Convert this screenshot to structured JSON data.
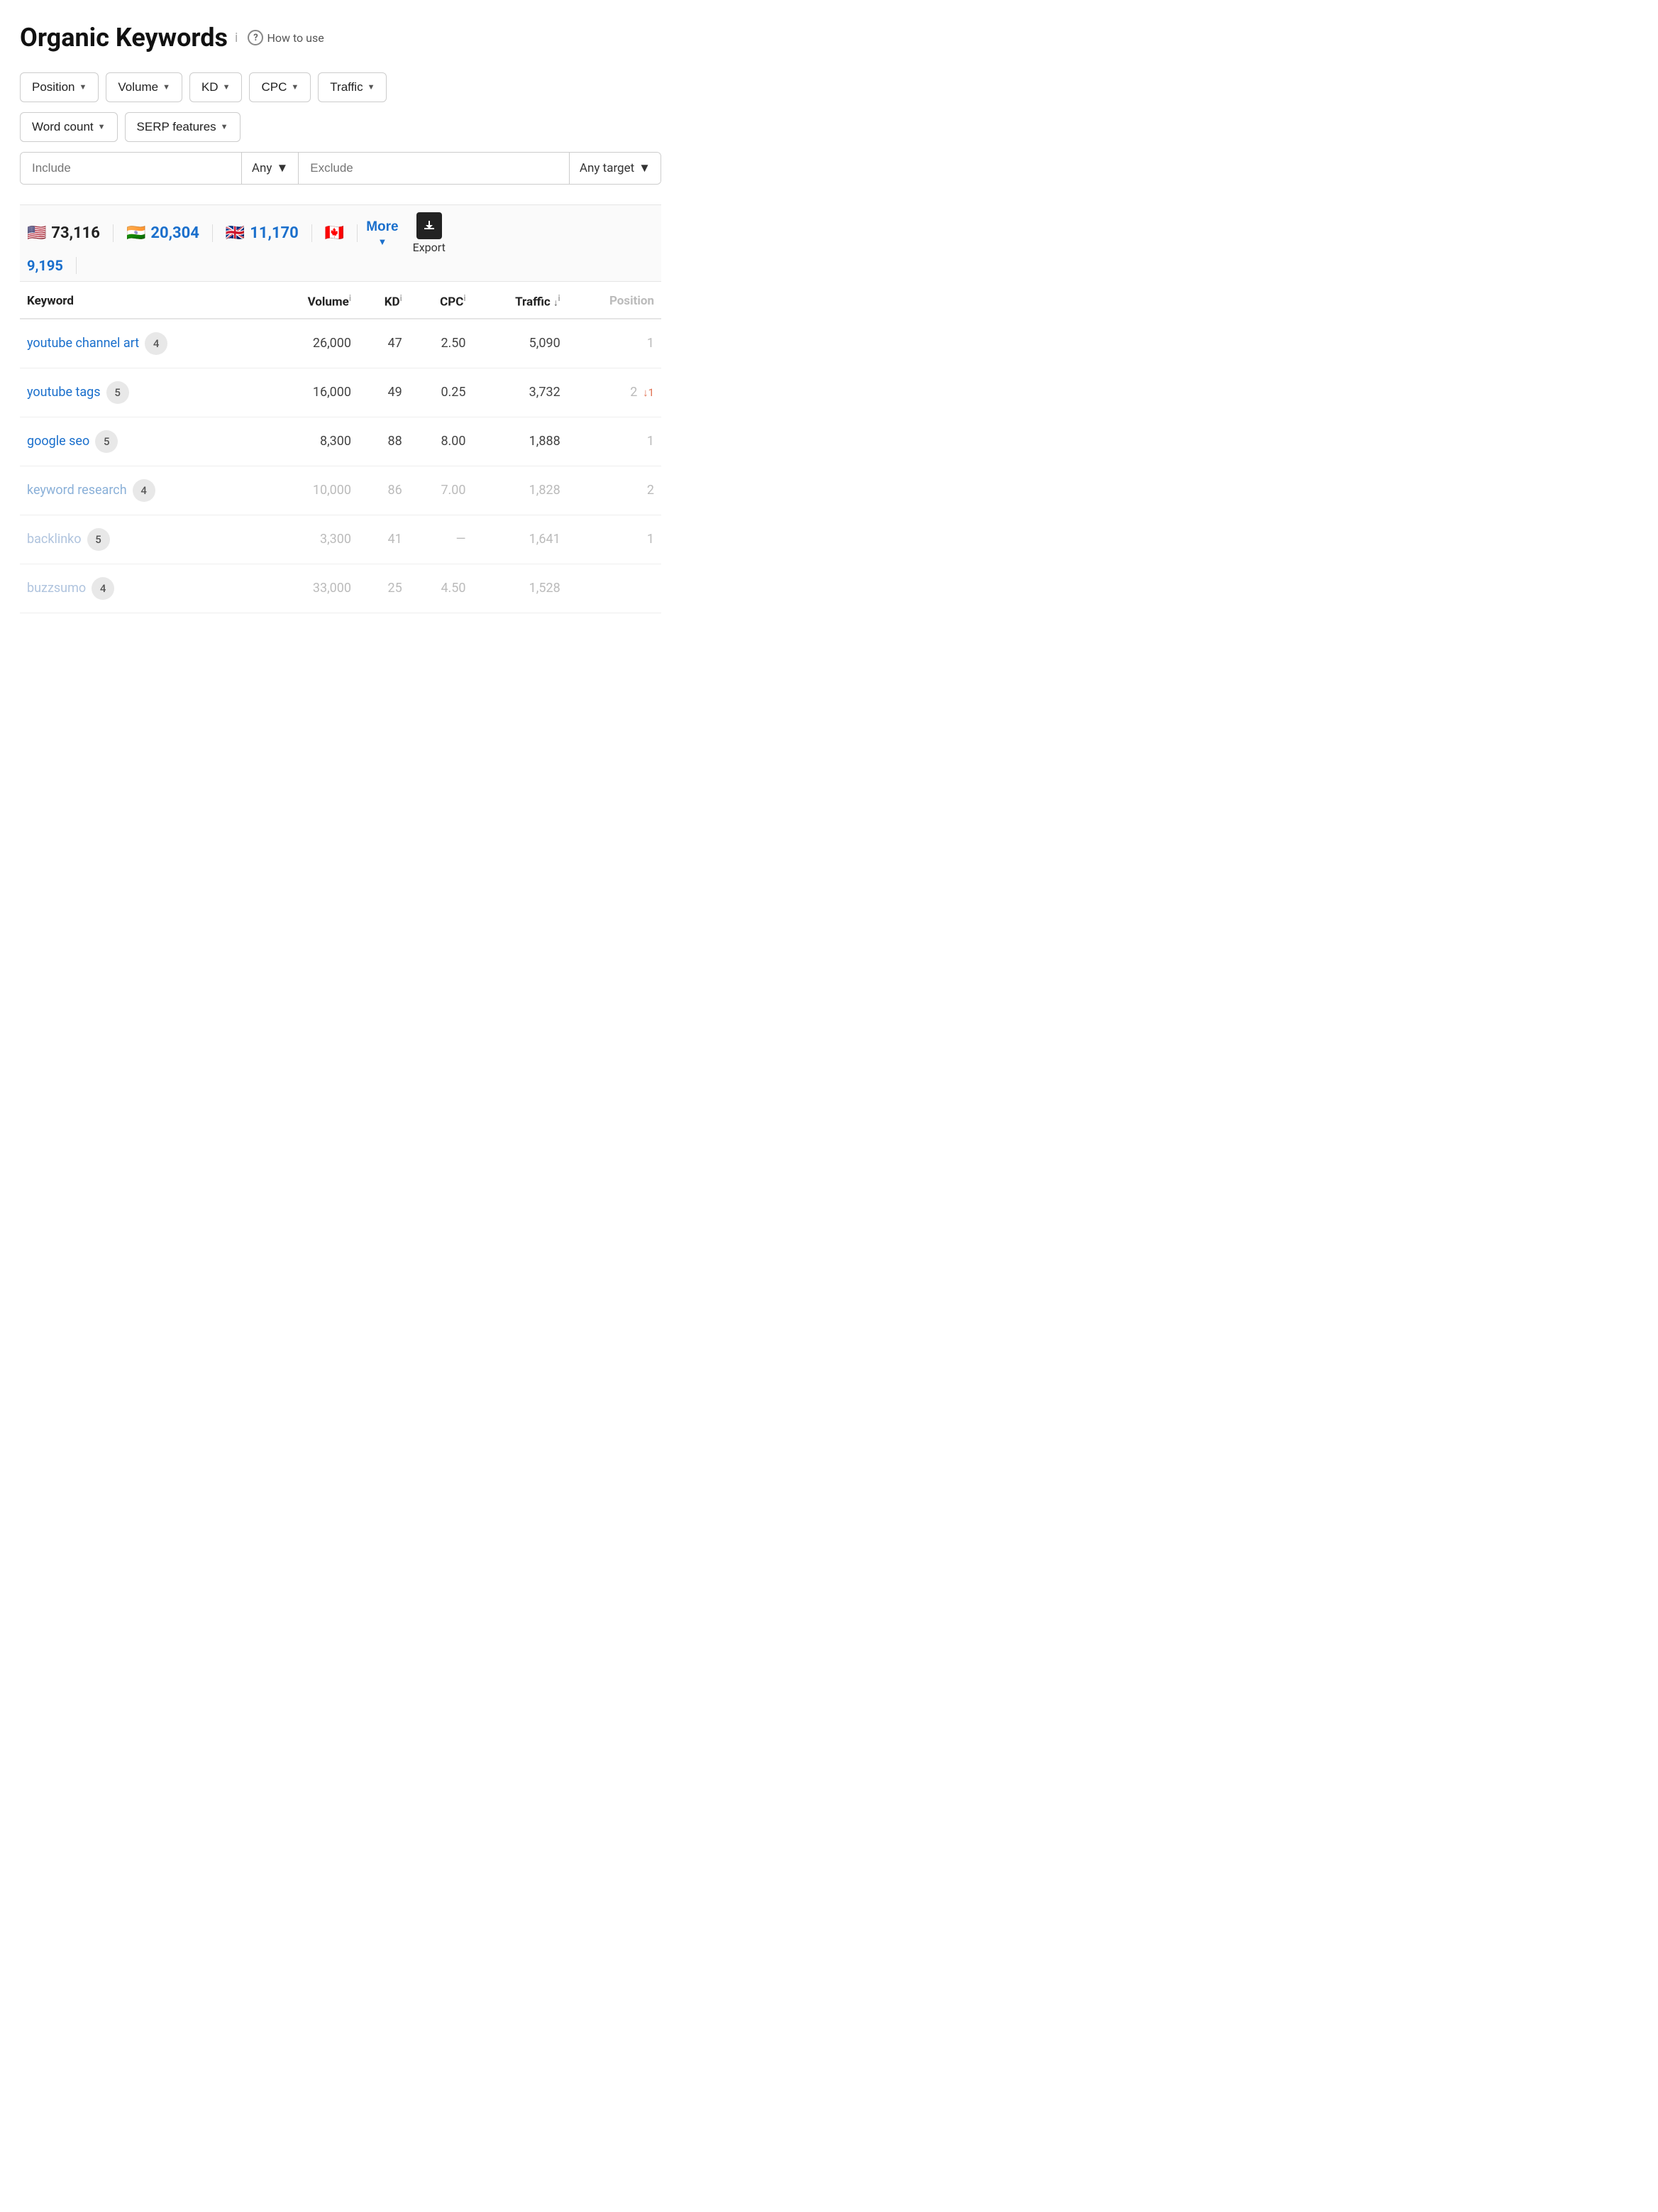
{
  "header": {
    "title": "Organic Keywords",
    "info_icon": "i",
    "how_to_use": "How to use"
  },
  "filters": {
    "row1": [
      {
        "label": "Position",
        "id": "position"
      },
      {
        "label": "Volume",
        "id": "volume"
      },
      {
        "label": "KD",
        "id": "kd"
      },
      {
        "label": "CPC",
        "id": "cpc"
      },
      {
        "label": "Traffic",
        "id": "traffic"
      }
    ],
    "row2": [
      {
        "label": "Word count",
        "id": "word-count"
      },
      {
        "label": "SERP features",
        "id": "serp-features"
      }
    ],
    "include_placeholder": "Include",
    "any_label": "Any",
    "exclude_placeholder": "Exclude",
    "any_target_label": "Any target"
  },
  "stats": {
    "us": {
      "flag": "🇺🇸",
      "value": "73,116"
    },
    "in": {
      "flag": "🇮🇳",
      "value": "20,304"
    },
    "gb": {
      "flag": "🇬🇧",
      "value": "11,170"
    },
    "ca": {
      "flag": "🇨🇦",
      "value": "9,195"
    },
    "more_label": "More",
    "export_label": "Export"
  },
  "table": {
    "headers": [
      {
        "label": "Keyword",
        "id": "keyword",
        "muted": false,
        "sortable": false
      },
      {
        "label": "Volume",
        "id": "volume",
        "muted": false,
        "sortable": false,
        "info": true
      },
      {
        "label": "KD",
        "id": "kd",
        "muted": false,
        "sortable": false,
        "info": true
      },
      {
        "label": "CPC",
        "id": "cpc",
        "muted": false,
        "sortable": false,
        "info": true
      },
      {
        "label": "Traffic",
        "id": "traffic",
        "muted": false,
        "sortable": true,
        "info": true
      },
      {
        "label": "Position",
        "id": "position",
        "muted": true,
        "sortable": false
      }
    ],
    "rows": [
      {
        "keyword": "youtube channel art",
        "keyword_link": true,
        "muted": false,
        "word_count": "4",
        "volume": "26,000",
        "kd": "47",
        "cpc": "2.50",
        "traffic": "5,090",
        "position": "1",
        "pos_change": null
      },
      {
        "keyword": "youtube tags",
        "keyword_link": true,
        "muted": false,
        "word_count": "5",
        "volume": "16,000",
        "kd": "49",
        "cpc": "0.25",
        "traffic": "3,732",
        "position": "2",
        "pos_change": "↓1"
      },
      {
        "keyword": "google seo",
        "keyword_link": true,
        "muted": false,
        "word_count": "5",
        "volume": "8,300",
        "kd": "88",
        "cpc": "8.00",
        "traffic": "1,888",
        "position": "1",
        "pos_change": null
      },
      {
        "keyword": "keyword research",
        "keyword_link": true,
        "muted": true,
        "word_count": "4",
        "volume": "10,000",
        "kd": "86",
        "cpc": "7.00",
        "traffic": "1,828",
        "position": "2",
        "pos_change": null
      },
      {
        "keyword": "backlinko",
        "keyword_link": false,
        "muted": true,
        "word_count": "5",
        "volume": "3,300",
        "kd": "41",
        "cpc": "—",
        "traffic": "1,641",
        "position": "1",
        "pos_change": null
      },
      {
        "keyword": "buzzsumo",
        "keyword_link": false,
        "muted": true,
        "word_count": "4",
        "volume": "33,000",
        "kd": "25",
        "cpc": "4.50",
        "traffic": "1,528",
        "position": "",
        "pos_change": null
      }
    ]
  }
}
